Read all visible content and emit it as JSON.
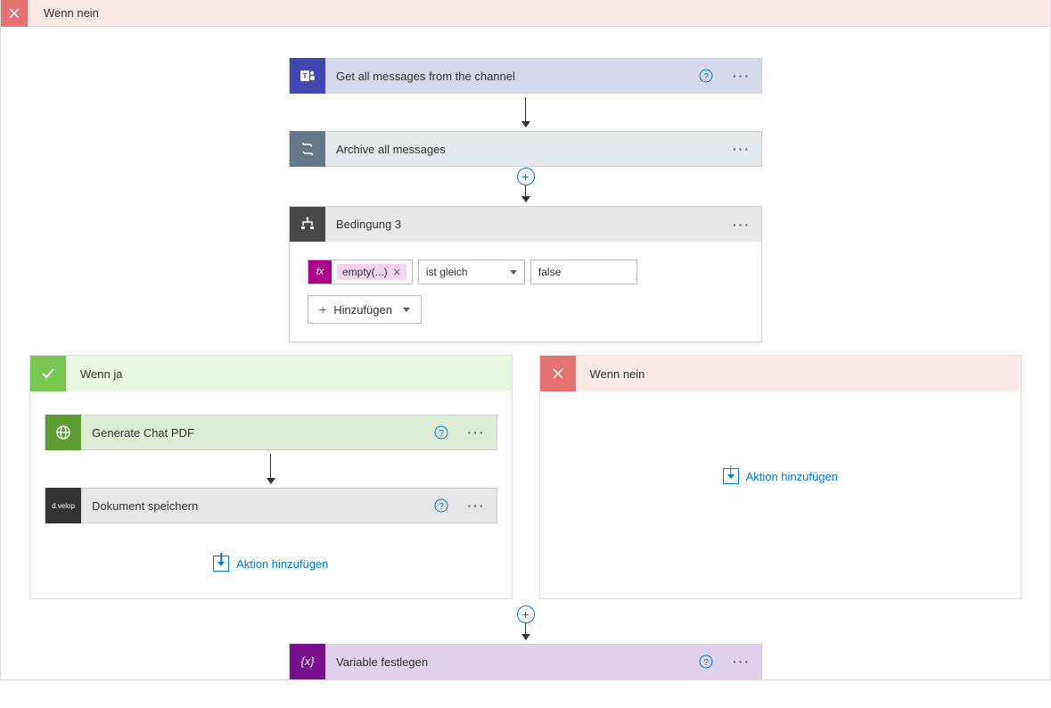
{
  "outerHeader": {
    "label": "Wenn nein"
  },
  "steps": {
    "teams": {
      "label": "Get all messages from the channel"
    },
    "archive": {
      "label": "Archive all messages"
    },
    "condition": {
      "title": "Bedingung 3",
      "expr_label": "empty(...)",
      "operator": "ist gleich",
      "value": "false",
      "add_label": "Hinzufügen"
    },
    "pdf": {
      "label": "Generate Chat PDF"
    },
    "dvelop": {
      "label": "Dokument speichern",
      "iconText": "d.velop"
    },
    "variable": {
      "label": "Variable festlegen"
    }
  },
  "branches": {
    "yes": {
      "label": "Wenn ja"
    },
    "no": {
      "label": "Wenn nein"
    }
  },
  "addAction": "Aktion hinzufügen"
}
